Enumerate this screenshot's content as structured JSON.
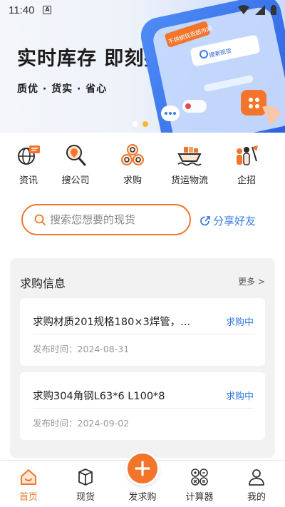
{
  "status_bar": {
    "time": "11:40",
    "notification": "A"
  },
  "banner": {
    "headline": "实时库存 即刻提货",
    "tagline": "质优 · 货实 · 省心",
    "art_tag": "不锈钢现货超市网",
    "art_search": "搜索现货",
    "slide_count": 2,
    "active_slide": 2
  },
  "quick_nav": [
    {
      "label": "资讯",
      "icon": "globe-news-icon"
    },
    {
      "label": "搜公司",
      "icon": "magnifier-map-pin-icon"
    },
    {
      "label": "求购",
      "icon": "circles-icon"
    },
    {
      "label": "货运物流",
      "icon": "cargo-ship-icon"
    },
    {
      "label": "企招",
      "icon": "recruitment-people-icon"
    }
  ],
  "search": {
    "placeholder": "搜索您想要的现货"
  },
  "share": {
    "label": "分享好友"
  },
  "purchase": {
    "title": "求购信息",
    "more": "更多 >",
    "items": [
      {
        "title": "求购材质201规格180×3焊管，...",
        "status": "求购中",
        "date": "发布时间：2024-08-31"
      },
      {
        "title": "求购304角钢L63*6 L100*8",
        "status": "求购中",
        "date": "发布时间：2024-09-02"
      }
    ]
  },
  "bottom_nav": [
    {
      "label": "首页",
      "icon": "home-icon",
      "active": true
    },
    {
      "label": "现货",
      "icon": "stock-box-icon",
      "active": false
    },
    {
      "label": "发求购",
      "icon": "plus-icon",
      "active": false
    },
    {
      "label": "计算器",
      "icon": "calculator-icon",
      "active": false
    },
    {
      "label": "我的",
      "icon": "user-icon",
      "active": false
    }
  ],
  "colors": {
    "accent": "#f3752b",
    "link": "#2f78e6",
    "dot_active": "#f5b31b"
  }
}
